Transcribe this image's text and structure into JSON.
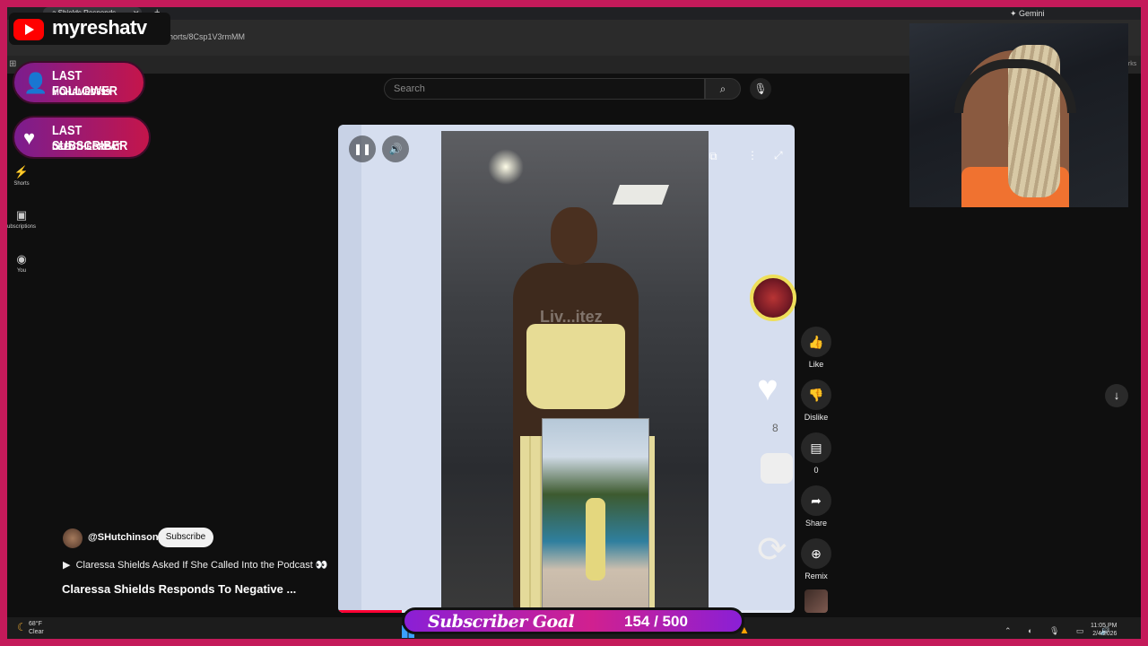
{
  "browser": {
    "tab_title": "a Shields Responds",
    "tab_close": "✕",
    "tab_new": "+",
    "gemini_label": "✦ Gemini",
    "url": "horts/8Csp1V3rmMM",
    "apps_glyph": "⊞",
    "bookmarks_right": "arks"
  },
  "youtube": {
    "search_placeholder": "Search",
    "search_icon": "search-icon",
    "mic_icon": "mic-icon",
    "sidebar": [
      {
        "label": "Shorts",
        "icon": "shorts-icon"
      },
      {
        "label": "ubscriptions",
        "icon": "subscriptions-icon"
      },
      {
        "label": "You",
        "icon": "account-icon"
      }
    ],
    "player": {
      "watermark": "Liv...itez",
      "progress_fraction": 0.14
    },
    "actions": {
      "like": "Like",
      "dislike": "Dislike",
      "comments_count": "0",
      "share": "Share",
      "remix": "Remix"
    },
    "ghost_count": "8",
    "channel_handle": "@SHutchinson",
    "subscribe_label": "Subscribe",
    "playlink_text": "Claressa Shields Asked If She Called Into the Podcast 👀",
    "video_title": "Claressa Shields Responds To Negative ..."
  },
  "taskbar": {
    "temperature": "68°F",
    "condition": "Clear",
    "time": "11:05 PM",
    "date": "2/4/2026",
    "tray": "⌃ ◐ 🎙 ▭ 🔊"
  },
  "overlay": {
    "brand_name": "myreshatv",
    "last_follower_label": "LAST FOLLOWER",
    "last_follower_name": "MOHAMED899",
    "last_subscriber_label": "LAST SUBSCRIBER",
    "last_subscriber_name": "DEENTHEGREAT",
    "goal_label": "Subscriber Goal",
    "goal_value": "154 / 500"
  },
  "colors": {
    "border": "#c41a5a",
    "youtube_red": "#ff0000",
    "background": "#0f0f0f"
  }
}
